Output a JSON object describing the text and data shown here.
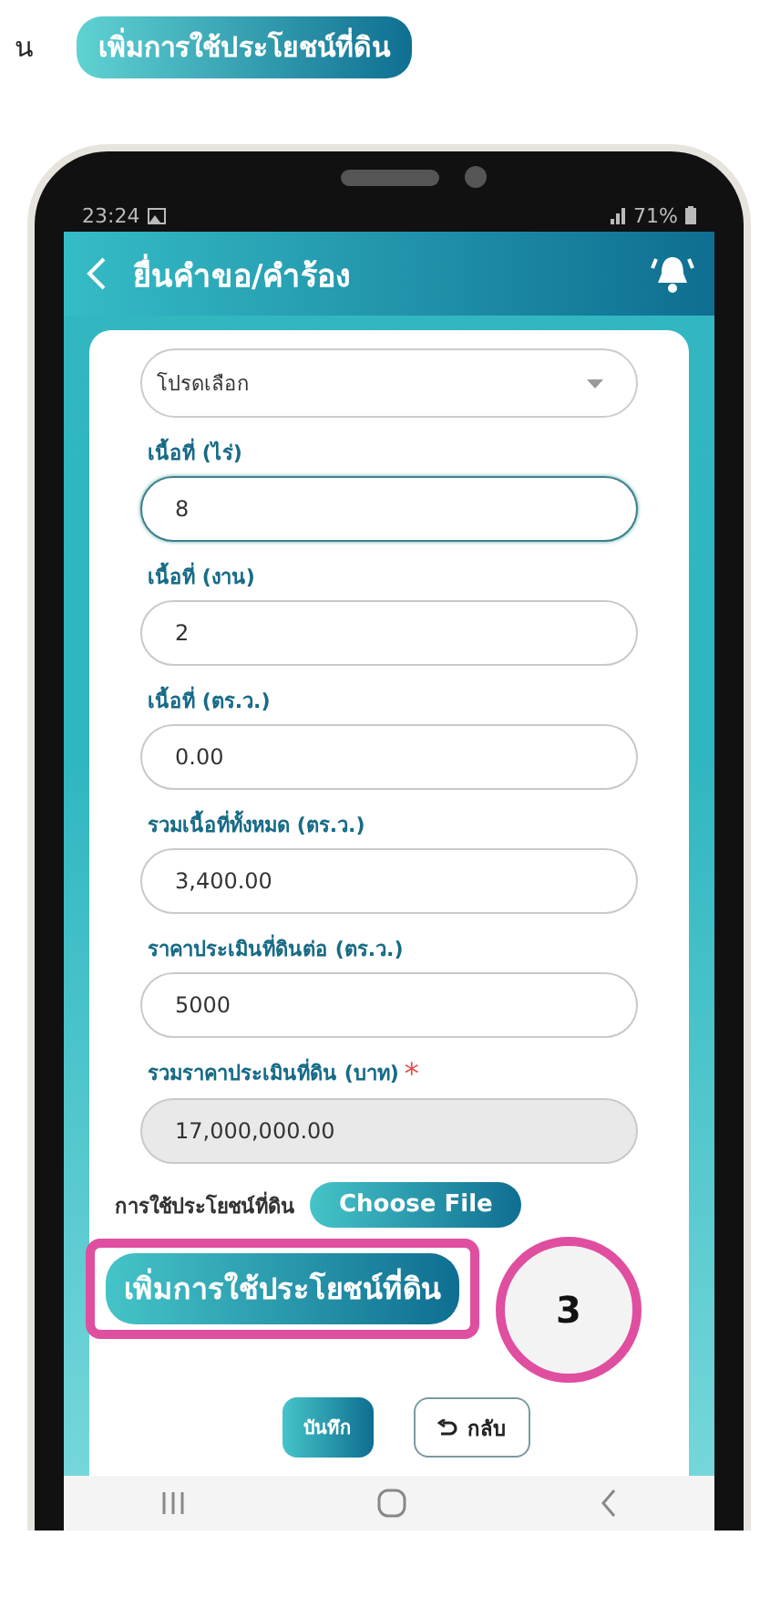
{
  "edge_fragment": "น",
  "annotation_title": "เพิ่มการใช้ประโยชน์ที่ดิน",
  "status_bar": {
    "time": "23:24",
    "battery": "71%"
  },
  "header": {
    "title": "ยื่นคำขอ/คำร้อง"
  },
  "select": {
    "placeholder": "โปรดเลือก"
  },
  "fields": [
    {
      "label": "เนื้อที่ (ไร่)",
      "value": "8",
      "focused": true,
      "readonly": false
    },
    {
      "label": "เนื้อที่ (งาน)",
      "value": "2",
      "focused": false,
      "readonly": false
    },
    {
      "label": "เนื้อที่ (ตร.ว.)",
      "value": "0.00",
      "focused": false,
      "readonly": false
    },
    {
      "label": "รวมเนื้อที่ทั้งหมด (ตร.ว.)",
      "value": "3,400.00",
      "focused": false,
      "readonly": false
    },
    {
      "label": "ราคาประเมินที่ดินต่อ (ตร.ว.)",
      "value": "5000",
      "focused": false,
      "readonly": false
    },
    {
      "label": "รวมราคาประเมินที่ดิน (บาท)",
      "required_mark": "*",
      "value": "17,000,000.00",
      "focused": false,
      "readonly": true
    }
  ],
  "file_input": {
    "label": "การใช้ประโยชน์ที่ดิน",
    "button": "Choose File"
  },
  "add_button": "เพิ่มการใช้ประโยชน์ที่ดิน",
  "step_badge": "3",
  "actions": [
    {
      "kind": "primary",
      "label": "บันทึก"
    },
    {
      "kind": "back",
      "label": "กลับ"
    }
  ]
}
